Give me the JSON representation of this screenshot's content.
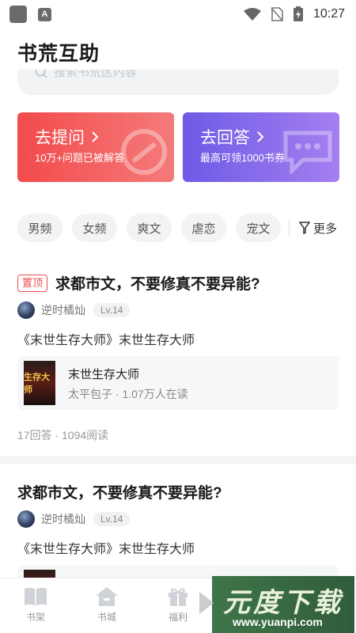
{
  "status_bar": {
    "time": "10:27"
  },
  "header": {
    "title": "书荒互助"
  },
  "search": {
    "placeholder": "搜索书荒区内容"
  },
  "promo": {
    "ask": {
      "title": "去提问",
      "subtitle": "10万+问题已被解答",
      "color_start": "#f24b4b",
      "color_end": "#f57a7a"
    },
    "answer": {
      "title": "去回答",
      "subtitle": "最高可领1000书券",
      "color_start": "#6e5ae6",
      "color_end": "#a47ff0"
    }
  },
  "categories": [
    "男频",
    "女频",
    "爽文",
    "虐恋",
    "宠文"
  ],
  "more_label": "更多",
  "posts": [
    {
      "pinned": "置顶",
      "title": "求都市文，不要修真不要异能?",
      "author": "逆时橘灿",
      "level": "Lv.14",
      "body": "《末世生存大师》末世生存大师",
      "book": {
        "name": "末世生存大师",
        "meta": "太平包子 · 1.07万人在读",
        "cover_text": "生存大师"
      },
      "stats": "17回答 · 1094阅读"
    },
    {
      "title": "求都市文，不要修真不要异能?",
      "author": "逆时橘灿",
      "level": "Lv.14",
      "body": "《末世生存大师》末世生存大师"
    }
  ],
  "bottom_nav": [
    {
      "label": "书架",
      "icon": "book-icon"
    },
    {
      "label": "书城",
      "icon": "home-icon"
    },
    {
      "label": "福利",
      "icon": "gift-icon"
    }
  ],
  "watermark": {
    "title": "元度下载",
    "url": "www.yuanpi.com"
  },
  "colors": {
    "accent_red": "#ef4b4b",
    "accent_purple": "#7b62ea"
  }
}
